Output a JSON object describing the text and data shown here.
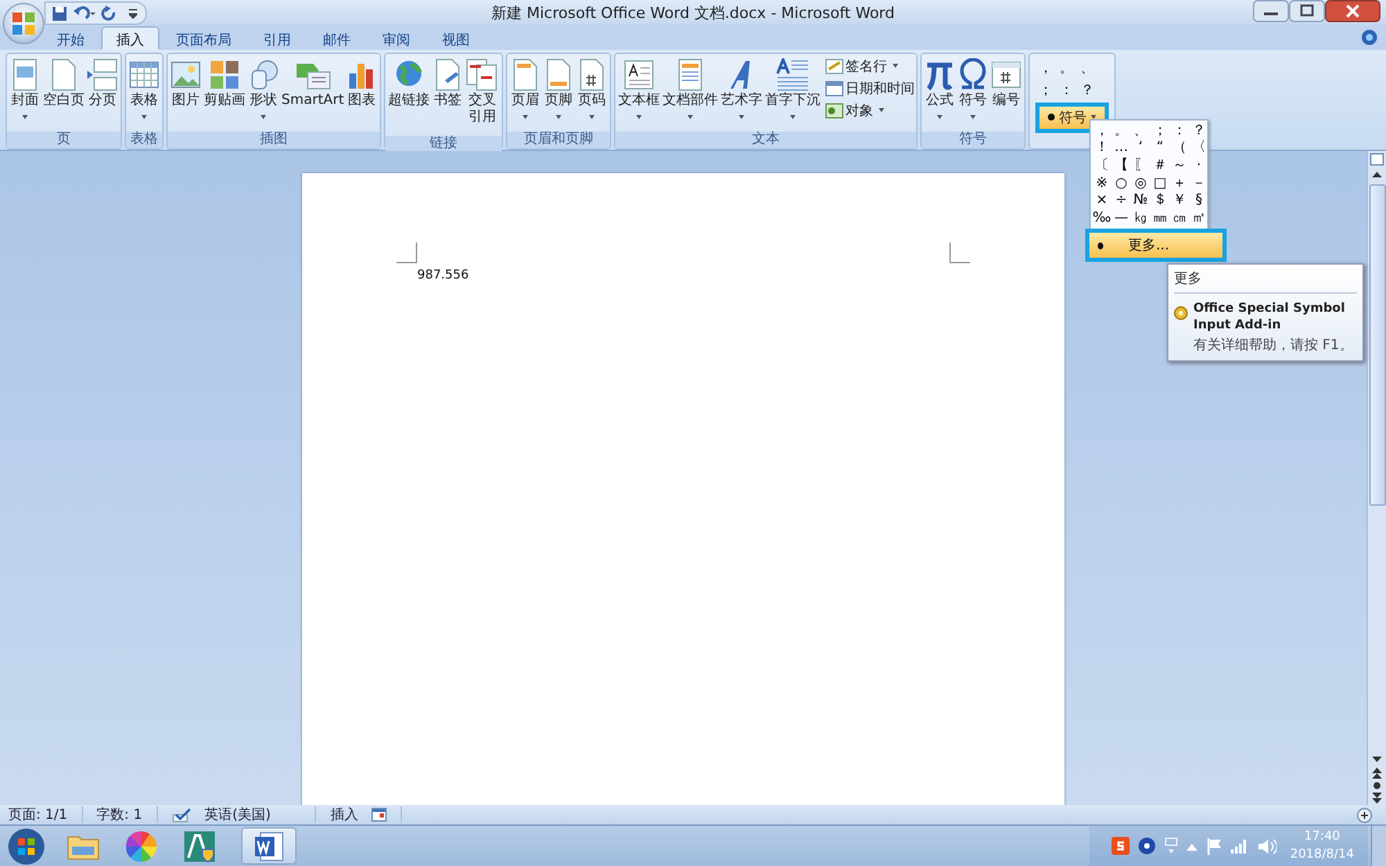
{
  "window": {
    "title": "新建 Microsoft Office Word 文档.docx - Microsoft Word"
  },
  "tabs": [
    {
      "label": "开始",
      "selected": false
    },
    {
      "label": "插入",
      "selected": true
    },
    {
      "label": "页面布局",
      "selected": false
    },
    {
      "label": "引用",
      "selected": false
    },
    {
      "label": "邮件",
      "selected": false
    },
    {
      "label": "审阅",
      "selected": false
    },
    {
      "label": "视图",
      "selected": false
    }
  ],
  "ribbon": {
    "groups": [
      {
        "label": "页",
        "buttons": [
          {
            "label": "封面",
            "kind": "large",
            "has_menu": true
          },
          {
            "label": "空白页",
            "kind": "large",
            "has_menu": false
          },
          {
            "label": "分页",
            "kind": "large",
            "has_menu": false
          }
        ]
      },
      {
        "label": "表格",
        "buttons": [
          {
            "label": "表格",
            "kind": "large",
            "has_menu": true
          }
        ]
      },
      {
        "label": "插图",
        "buttons": [
          {
            "label": "图片",
            "kind": "large",
            "has_menu": false
          },
          {
            "label": "剪贴画",
            "kind": "large",
            "has_menu": false
          },
          {
            "label": "形状",
            "kind": "large",
            "has_menu": true
          },
          {
            "label": "SmartArt",
            "kind": "large",
            "has_menu": false
          },
          {
            "label": "图表",
            "kind": "large",
            "has_menu": false
          }
        ]
      },
      {
        "label": "链接",
        "buttons": [
          {
            "label": "超链接",
            "kind": "large",
            "has_menu": false
          },
          {
            "label": "书签",
            "kind": "large",
            "has_menu": false
          },
          {
            "label": "交叉引用",
            "kind": "large_wrapped",
            "has_menu": false
          }
        ]
      },
      {
        "label": "页眉和页脚",
        "buttons": [
          {
            "label": "页眉",
            "kind": "large",
            "has_menu": true
          },
          {
            "label": "页脚",
            "kind": "large",
            "has_menu": true
          },
          {
            "label": "页码",
            "kind": "large",
            "has_menu": true
          }
        ]
      },
      {
        "label": "文本",
        "buttons": [
          {
            "label": "文本框",
            "kind": "large",
            "has_menu": true
          },
          {
            "label": "文档部件",
            "kind": "large",
            "has_menu": true
          },
          {
            "label": "艺术字",
            "kind": "large",
            "has_menu": true
          },
          {
            "label": "首字下沉",
            "kind": "large",
            "has_menu": true
          },
          {
            "label": "签名行",
            "kind": "small",
            "has_menu": true
          },
          {
            "label": "日期和时间",
            "kind": "small",
            "has_menu": false
          },
          {
            "label": "对象",
            "kind": "small",
            "has_menu": true
          }
        ]
      },
      {
        "label": "符号",
        "buttons": [
          {
            "label": "公式",
            "kind": "large",
            "has_menu": true
          },
          {
            "label": "符号",
            "kind": "large",
            "has_menu": true
          },
          {
            "label": "编号",
            "kind": "large",
            "has_menu": false
          }
        ]
      }
    ],
    "special_symbols": {
      "symbols": [
        "，",
        "。",
        "、",
        "；",
        "：",
        "？"
      ],
      "button": {
        "label": "符号",
        "highlighted": true
      }
    }
  },
  "symbol_menu": {
    "symbols": [
      "，",
      "。",
      "、",
      "；",
      "：",
      "？",
      "！",
      "…",
      "‘",
      "“",
      "（",
      "〈",
      "〔",
      "【",
      "〖",
      "＃",
      "～",
      "·",
      "※",
      "○",
      "◎",
      "□",
      "＋",
      "－",
      "×",
      "÷",
      "№",
      "＄",
      "￥",
      "§",
      "‰",
      "—",
      "㎏",
      "㎜",
      "㎝",
      "㎡"
    ],
    "more": {
      "label": "更多...",
      "highlighted": true
    }
  },
  "tooltip": {
    "title": "更多",
    "heading": "Office Special Symbol Input Add-in",
    "hint": "有关详细帮助，请按 F1。"
  },
  "document": {
    "text": "987.556"
  },
  "status_bar": {
    "page": "页面: 1/1",
    "words": "字数: 1",
    "language": "英语(美国)",
    "mode": "插入"
  },
  "taskbar": {
    "apps": [
      {
        "selected": false
      },
      {
        "selected": false
      },
      {
        "selected": false
      },
      {
        "selected": true
      }
    ],
    "time": "17:40",
    "date": "2018/8/14"
  }
}
